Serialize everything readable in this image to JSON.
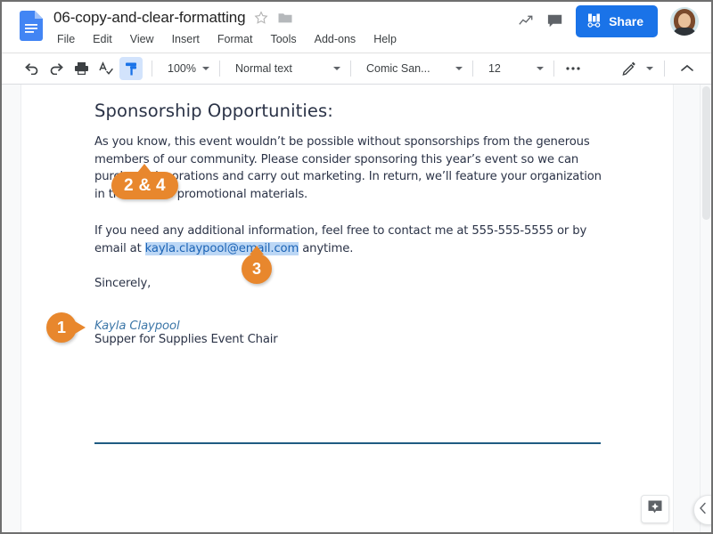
{
  "app": {
    "doc_icon": "google-docs-icon",
    "title": "06-copy-and-clear-formatting",
    "star_icon": "star-outline-icon",
    "folder_icon": "folder-icon"
  },
  "menubar": {
    "items": [
      {
        "label": "File"
      },
      {
        "label": "Edit"
      },
      {
        "label": "View"
      },
      {
        "label": "Insert"
      },
      {
        "label": "Format"
      },
      {
        "label": "Tools"
      },
      {
        "label": "Add-ons"
      },
      {
        "label": "Help"
      }
    ]
  },
  "header_right": {
    "activity_icon": "activity-trend-icon",
    "comments_icon": "comment-icon",
    "share_label": "Share",
    "share_icon": "share-lock-icon",
    "share_color": "#1a73e8",
    "avatar": "user-avatar"
  },
  "toolbar": {
    "undo_icon": "undo-icon",
    "redo_icon": "redo-icon",
    "print_icon": "print-icon",
    "spellcheck_icon": "spellcheck-icon",
    "paint_format_icon": "paint-format-icon",
    "paint_format_active": true,
    "zoom_value": "100%",
    "style_value": "Normal text",
    "font_value": "Comic San...",
    "font_size_value": "12",
    "more_icon": "more-options-icon",
    "edit_mode_icon": "pencil-icon",
    "collapse_toolbar_icon": "chevron-up-icon"
  },
  "document": {
    "heading": "Sponsorship Opportunities:",
    "paragraph1": "As you know, this event wouldn’t be possible without sponsorships from the generous members of our community. Please consider sponsoring this year’s event so we can purchase decorations and carry out marketing. In return, we’ll feature your organization in the event’s promotional materials.",
    "paragraph2_before": "If you need any additional information, feel free to contact me at 555-555-5555 or by email at ",
    "email": "kayla.claypool@email.com",
    "paragraph2_after": " anytime.",
    "closing": "Sincerely,",
    "signature_name": "Kayla Claypool",
    "signature_role": "Supper for Supplies Event Chair",
    "horizontal_rule_color": "#1f5b82",
    "link_color": "#1b63b5",
    "selection_color": "#bcd7f5"
  },
  "callouts": [
    {
      "id": "callout-2-and-4",
      "label": "2 & 4",
      "shape": "pill",
      "pointer": "up"
    },
    {
      "id": "callout-3",
      "label": "3",
      "shape": "circle",
      "pointer": "up"
    },
    {
      "id": "callout-1",
      "label": "1",
      "shape": "circle",
      "pointer": "right"
    }
  ],
  "callout_color": "#e8872d",
  "widgets": {
    "explore_icon": "explore-icon",
    "collapse_panel_icon": "chevron-left-icon"
  }
}
